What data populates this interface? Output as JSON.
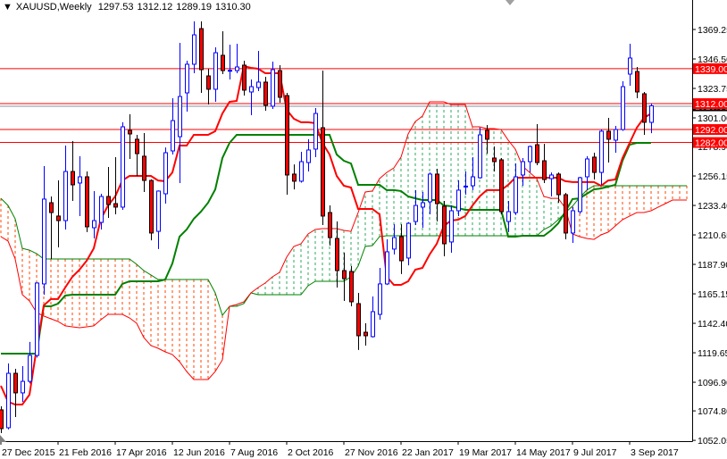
{
  "header": {
    "symbol": "XAUUSD,Weekly",
    "open": "1297.53",
    "high": "1312.12",
    "low": "1289.19",
    "close": "1310.30"
  },
  "colors": {
    "bull": "#0000ff",
    "bear": "#ff0000",
    "tenkan": "#ff0000",
    "kijun": "#008000",
    "cloud_bear": "#ff4500",
    "cloud_bull": "#2eaa5c",
    "level": "#ff0000",
    "price_line": "#8090a0"
  },
  "chart_data": {
    "type": "candlestick",
    "title": "XAUUSD,Weekly",
    "ylim": [
      1052.05,
      1369.25
    ],
    "y_ticks": [
      "1369.25",
      "1346.50",
      "1323.75",
      "1301.00",
      "1278.90",
      "1256.15",
      "1233.40",
      "1210.65",
      "1187.90",
      "1165.15",
      "1142.40",
      "1119.65",
      "1096.90",
      "1074.80",
      "1052.05"
    ],
    "x_labels": [
      {
        "label": "27 Dec 2015",
        "index": 0
      },
      {
        "label": "21 Feb 2016",
        "index": 8
      },
      {
        "label": "17 Apr 2016",
        "index": 16
      },
      {
        "label": "12 Jun 2016",
        "index": 24
      },
      {
        "label": "7 Aug 2016",
        "index": 32
      },
      {
        "label": "2 Oct 2016",
        "index": 40
      },
      {
        "label": "27 Nov 2016",
        "index": 48
      },
      {
        "label": "22 Jan 2017",
        "index": 56
      },
      {
        "label": "19 Mar 2017",
        "index": 64
      },
      {
        "label": "14 May 2017",
        "index": 72
      },
      {
        "label": "9 Jul 2017",
        "index": 80
      },
      {
        "label": "3 Sep 2017",
        "index": 88
      }
    ],
    "ohlc": [
      [
        1075.6,
        1078.3,
        1057.6,
        1061.1
      ],
      [
        1061.8,
        1111.4,
        1060.5,
        1103.8
      ],
      [
        1103.8,
        1107.3,
        1070.0,
        1088.7
      ],
      [
        1088.7,
        1109.3,
        1081.8,
        1097.6
      ],
      [
        1097.6,
        1128.0,
        1096.0,
        1117.6
      ],
      [
        1117.6,
        1174.0,
        1116.0,
        1173.5
      ],
      [
        1172.8,
        1263.8,
        1164.5,
        1238.3
      ],
      [
        1235.5,
        1240.3,
        1192.1,
        1227.9
      ],
      [
        1225.2,
        1252.7,
        1201.0,
        1221.7
      ],
      [
        1221.7,
        1279.6,
        1214.8,
        1259.6
      ],
      [
        1259.6,
        1283.1,
        1236.9,
        1249.3
      ],
      [
        1250.7,
        1271.4,
        1225.2,
        1255.5
      ],
      [
        1255.5,
        1259.6,
        1212.8,
        1216.9
      ],
      [
        1216.2,
        1244.5,
        1207.9,
        1221.7
      ],
      [
        1220.3,
        1242.4,
        1214.8,
        1240.3
      ],
      [
        1240.3,
        1263.1,
        1223.8,
        1234.1
      ],
      [
        1234.8,
        1270.7,
        1226.5,
        1232.1
      ],
      [
        1232.1,
        1297.6,
        1230.0,
        1294.1
      ],
      [
        1291.3,
        1303.8,
        1269.3,
        1288.6
      ],
      [
        1284.5,
        1287.9,
        1256.2,
        1273.4
      ],
      [
        1271.4,
        1289.3,
        1243.8,
        1252.7
      ],
      [
        1252.7,
        1253.5,
        1206.5,
        1212.1
      ],
      [
        1213.4,
        1245.0,
        1199.7,
        1244.5
      ],
      [
        1242.4,
        1278.2,
        1234.8,
        1274.1
      ],
      [
        1275.5,
        1316.2,
        1272.7,
        1298.9
      ],
      [
        1286.5,
        1358.9,
        1250.7,
        1317.5
      ],
      [
        1320.3,
        1345.1,
        1305.8,
        1342.4
      ],
      [
        1342.4,
        1375.5,
        1335.5,
        1365.1
      ],
      [
        1369.9,
        1375.5,
        1320.3,
        1338.2
      ],
      [
        1333.4,
        1338.9,
        1311.3,
        1323.1
      ],
      [
        1323.1,
        1355.5,
        1313.4,
        1351.3
      ],
      [
        1349.3,
        1367.9,
        1334.8,
        1337.5
      ],
      [
        1337.3,
        1357.5,
        1330.6,
        1337.7
      ],
      [
        1337.5,
        1358.2,
        1335.5,
        1340.3
      ],
      [
        1341.7,
        1345.1,
        1318.2,
        1322.4
      ],
      [
        1321.0,
        1330.6,
        1303.1,
        1325.1
      ],
      [
        1324.4,
        1352.7,
        1321.7,
        1328.6
      ],
      [
        1328.6,
        1332.7,
        1306.5,
        1310.7
      ],
      [
        1310.0,
        1344.4,
        1307.9,
        1338.2
      ],
      [
        1337.5,
        1341.7,
        1312.7,
        1316.9
      ],
      [
        1318.2,
        1320.3,
        1241.7,
        1256.9
      ],
      [
        1257.6,
        1265.1,
        1245.8,
        1252.1
      ],
      [
        1252.1,
        1274.8,
        1251.0,
        1267.2
      ],
      [
        1266.5,
        1284.5,
        1259.6,
        1276.2
      ],
      [
        1276.9,
        1308.6,
        1270.7,
        1304.4
      ],
      [
        1293.4,
        1337.5,
        1218.3,
        1225.2
      ],
      [
        1227.9,
        1233.4,
        1202.4,
        1208.6
      ],
      [
        1207.9,
        1221.0,
        1170.0,
        1183.1
      ],
      [
        1183.1,
        1196.9,
        1159.7,
        1176.9
      ],
      [
        1182.4,
        1186.6,
        1155.5,
        1159.0
      ],
      [
        1157.6,
        1165.9,
        1121.8,
        1132.8
      ],
      [
        1135.5,
        1142.4,
        1125.2,
        1132.8
      ],
      [
        1132.1,
        1163.1,
        1131.4,
        1151.4
      ],
      [
        1149.3,
        1185.2,
        1145.2,
        1172.8
      ],
      [
        1172.8,
        1207.2,
        1172.0,
        1197.6
      ],
      [
        1199.7,
        1218.9,
        1195.5,
        1208.6
      ],
      [
        1209.3,
        1218.9,
        1180.4,
        1190.7
      ],
      [
        1192.8,
        1220.5,
        1187.2,
        1219.6
      ],
      [
        1221.0,
        1245.2,
        1218.3,
        1233.4
      ],
      [
        1232.1,
        1243.8,
        1216.2,
        1235.5
      ],
      [
        1236.2,
        1258.9,
        1226.5,
        1257.6
      ],
      [
        1257.6,
        1261.7,
        1221.0,
        1234.8
      ],
      [
        1232.8,
        1236.9,
        1194.1,
        1203.8
      ],
      [
        1205.2,
        1233.4,
        1196.9,
        1229.3
      ],
      [
        1229.3,
        1252.7,
        1225.2,
        1245.2
      ],
      [
        1247.9,
        1259.6,
        1241.7,
        1248.3
      ],
      [
        1248.6,
        1270.7,
        1245.2,
        1255.5
      ],
      [
        1254.8,
        1293.4,
        1254.1,
        1287.9
      ],
      [
        1291.3,
        1295.5,
        1273.4,
        1284.5
      ],
      [
        1270.0,
        1278.9,
        1259.6,
        1267.2
      ],
      [
        1268.6,
        1270.0,
        1226.5,
        1228.6
      ],
      [
        1221.0,
        1236.9,
        1212.8,
        1228.6
      ],
      [
        1227.9,
        1265.8,
        1226.0,
        1255.5
      ],
      [
        1256.9,
        1270.0,
        1248.6,
        1267.2
      ],
      [
        1267.2,
        1279.6,
        1258.9,
        1278.9
      ],
      [
        1280.3,
        1296.2,
        1264.5,
        1266.5
      ],
      [
        1267.9,
        1281.0,
        1250.7,
        1253.4
      ],
      [
        1254.1,
        1258.9,
        1240.3,
        1256.9
      ],
      [
        1257.6,
        1258.9,
        1235.5,
        1241.7
      ],
      [
        1241.7,
        1243.1,
        1207.2,
        1212.1
      ],
      [
        1212.1,
        1232.1,
        1204.5,
        1229.3
      ],
      [
        1228.6,
        1255.5,
        1227.0,
        1254.8
      ],
      [
        1255.5,
        1271.4,
        1245.2,
        1269.3
      ],
      [
        1270.7,
        1274.1,
        1253.4,
        1258.9
      ],
      [
        1258.9,
        1292.0,
        1249.3,
        1290.7
      ],
      [
        1290.7,
        1301.0,
        1266.5,
        1284.5
      ],
      [
        1283.8,
        1294.8,
        1274.1,
        1292.0
      ],
      [
        1292.0,
        1329.3,
        1291.0,
        1325.1
      ],
      [
        1334.8,
        1358.2,
        1325.8,
        1347.2
      ],
      [
        1336.8,
        1340.3,
        1316.2,
        1321.0
      ],
      [
        1319.6,
        1321.0,
        1287.9,
        1297.6
      ],
      [
        1297.53,
        1312.12,
        1289.19,
        1310.3
      ]
    ],
    "tenkan": [
      1094.2,
      1081.8,
      1079.7,
      1079.7,
      1087.3,
      1123.1,
      1156.2,
      1161.1,
      1161.1,
      1170.0,
      1178.3,
      1183.8,
      1190.7,
      1200.3,
      1223.1,
      1233.4,
      1240.3,
      1252.7,
      1256.2,
      1256.2,
      1256.2,
      1256.2,
      1252.7,
      1252.1,
      1258.9,
      1279.6,
      1279.6,
      1287.9,
      1287.9,
      1287.9,
      1290.7,
      1304.4,
      1313.4,
      1314.1,
      1341.0,
      1339.6,
      1338.9,
      1335.5,
      1335.5,
      1335.5,
      1307.2,
      1300.3,
      1297.6,
      1297.6,
      1296.9,
      1281.7,
      1272.7,
      1256.2,
      1248.6,
      1247.2,
      1230.7,
      1230.7,
      1230.7,
      1226.5,
      1178.3,
      1172.1,
      1172.1,
      1174.8,
      1183.8,
      1185.2,
      1195.5,
      1203.8,
      1217.6,
      1221.7,
      1222.4,
      1225.2,
      1233.4,
      1240.3,
      1245.2,
      1245.2,
      1245.2,
      1249.3,
      1254.8,
      1254.8,
      1254.8,
      1254.8,
      1254.8,
      1254.8,
      1254.8,
      1252.1,
      1251.4,
      1251.4,
      1251.4,
      1251.4,
      1248.6,
      1252.7,
      1253.4,
      1270.0,
      1281.7,
      1293.4,
      1301.0,
      1304.4
    ],
    "kijun": [
      1119.0,
      1119.0,
      1119.0,
      1119.0,
      1119.0,
      1119.0,
      1155.5,
      1155.5,
      1157.6,
      1163.8,
      1164.5,
      1164.5,
      1164.5,
      1164.5,
      1164.5,
      1164.5,
      1164.5,
      1172.8,
      1174.8,
      1174.8,
      1174.8,
      1174.8,
      1174.8,
      1176.2,
      1188.6,
      1209.3,
      1214.8,
      1223.1,
      1228.6,
      1235.5,
      1245.8,
      1270.0,
      1281.7,
      1287.9,
      1287.9,
      1287.9,
      1287.9,
      1287.9,
      1287.9,
      1287.9,
      1287.9,
      1287.9,
      1287.9,
      1287.9,
      1287.9,
      1287.9,
      1287.9,
      1272.7,
      1267.9,
      1265.8,
      1249.3,
      1249.3,
      1249.3,
      1249.3,
      1245.2,
      1245.2,
      1244.5,
      1240.3,
      1238.9,
      1237.6,
      1237.6,
      1237.6,
      1233.4,
      1232.8,
      1231.4,
      1230.0,
      1230.0,
      1230.0,
      1230.0,
      1230.0,
      1230.0,
      1209.3,
      1209.3,
      1210.0,
      1210.0,
      1210.0,
      1210.0,
      1214.1,
      1219.6,
      1228.6,
      1238.3,
      1238.9,
      1242.4,
      1245.8,
      1246.5,
      1247.9,
      1249.3,
      1267.9,
      1280.3,
      1281.7,
      1281.7,
      1281.7
    ],
    "span_green": [
      1238.9,
      1233.4,
      1223.1,
      1200.3,
      1198.9,
      1196.2,
      1192.1,
      1192.1,
      1192.1,
      1192.1,
      1192.1,
      1192.1,
      1192.1,
      1192.1,
      1192.1,
      1192.1,
      1192.1,
      1192.1,
      1192.1,
      1187.9,
      1183.1,
      1179.7,
      1176.2,
      1176.2,
      1176.2,
      1176.2,
      1176.2,
      1176.2,
      1176.2,
      1176.2,
      1165.9,
      1148.6,
      1155.5,
      1155.5,
      1157.6,
      1165.9,
      1164.5,
      1164.5,
      1164.5,
      1164.5,
      1164.5,
      1164.5,
      1164.5,
      1171.4,
      1174.8,
      1174.8,
      1174.8,
      1174.8,
      1174.8,
      1178.3,
      1186.6,
      1201.7,
      1202.4,
      1209.3,
      1210.0,
      1210.0,
      1210.0,
      1210.0,
      1210.0,
      1210.0,
      1210.0,
      1210.0,
      1210.0,
      1210.0,
      1210.0,
      1210.0,
      1210.0,
      1210.0,
      1210.0,
      1210.0,
      1210.0,
      1210.0,
      1210.0,
      1210.0,
      1210.0,
      1210.0,
      1214.8,
      1217.6,
      1222.4,
      1227.9,
      1232.8,
      1239.6,
      1245.2,
      1248.6,
      1248.6,
      1248.6,
      1248.6,
      1248.6,
      1248.6,
      1248.6,
      1248.6,
      1248.6,
      1248.6,
      1248.6,
      1248.6,
      1248.6,
      1248.6
    ],
    "span_red": [
      1209.3,
      1205.9,
      1192.1,
      1164.5,
      1159.7,
      1150.7,
      1148.0,
      1145.9,
      1143.8,
      1140.4,
      1139.7,
      1139.0,
      1139.7,
      1140.4,
      1145.2,
      1149.3,
      1149.3,
      1149.3,
      1146.6,
      1142.4,
      1131.4,
      1125.2,
      1123.1,
      1120.4,
      1118.3,
      1112.8,
      1105.2,
      1099.0,
      1099.0,
      1099.0,
      1105.2,
      1114.2,
      1155.5,
      1156.9,
      1159.0,
      1165.9,
      1170.0,
      1173.5,
      1178.3,
      1181.7,
      1193.5,
      1201.7,
      1203.8,
      1211.4,
      1214.8,
      1215.5,
      1215.5,
      1215.5,
      1214.1,
      1213.4,
      1227.9,
      1243.8,
      1244.5,
      1254.1,
      1258.9,
      1262.4,
      1270.7,
      1288.6,
      1298.2,
      1302.4,
      1313.4,
      1313.4,
      1313.4,
      1311.3,
      1311.3,
      1311.3,
      1294.1,
      1294.1,
      1292.7,
      1292.7,
      1292.0,
      1283.8,
      1276.9,
      1263.8,
      1258.9,
      1254.1,
      1240.3,
      1238.9,
      1238.9,
      1231.4,
      1211.4,
      1209.3,
      1207.9,
      1207.2,
      1210.7,
      1212.8,
      1217.6,
      1222.4,
      1225.2,
      1227.9,
      1227.9,
      1229.3,
      1232.1,
      1234.8,
      1237.6,
      1237.6,
      1237.6
    ],
    "levels": [
      {
        "price": 1339.0,
        "label": "1339.00"
      },
      {
        "price": 1312.0,
        "label": "1312.00"
      },
      {
        "price": 1292.0,
        "label": "1292.00"
      },
      {
        "price": 1282.0,
        "label": "1282.00"
      }
    ],
    "current_price": {
      "price": 1310.3,
      "label": "1310.30"
    }
  }
}
